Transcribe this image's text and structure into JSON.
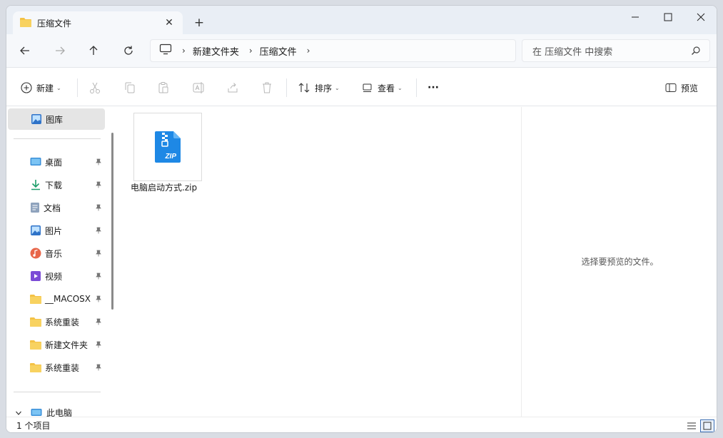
{
  "tab": {
    "title": "压缩文件",
    "close_label": "✕",
    "new_tab_label": "+"
  },
  "window_controls": {
    "minimize": "—",
    "maximize": "☐",
    "close": "✕"
  },
  "address": {
    "crumbs": [
      "新建文件夹",
      "压缩文件"
    ],
    "sep": "›"
  },
  "search": {
    "placeholder": "在 压缩文件 中搜索"
  },
  "toolbar": {
    "new_label": "新建",
    "sort_label": "排序",
    "view_label": "查看",
    "more_label": "···",
    "preview_label": "预览"
  },
  "sidebar": {
    "gallery_label": "图库",
    "items": [
      {
        "label": "桌面",
        "icon": "desktop-icon"
      },
      {
        "label": "下载",
        "icon": "download-icon"
      },
      {
        "label": "文档",
        "icon": "document-icon"
      },
      {
        "label": "图片",
        "icon": "pictures-icon"
      },
      {
        "label": "音乐",
        "icon": "music-icon"
      },
      {
        "label": "视频",
        "icon": "video-icon"
      },
      {
        "label": "__MACOSX",
        "icon": "folder-icon"
      },
      {
        "label": "系统重装",
        "icon": "folder-icon"
      },
      {
        "label": "新建文件夹",
        "icon": "folder-icon"
      },
      {
        "label": "系统重装",
        "icon": "folder-icon"
      }
    ],
    "this_pc_label": "此电脑"
  },
  "files": [
    {
      "name": "电脑启动方式.zip",
      "icon": "zip-file-icon"
    }
  ],
  "preview": {
    "message": "选择要预览的文件。"
  },
  "status": {
    "item_count": "1 个项目"
  },
  "colors": {
    "accent": "#2a7be4",
    "folder": "#f4c246",
    "zip": "#1e88e5"
  }
}
